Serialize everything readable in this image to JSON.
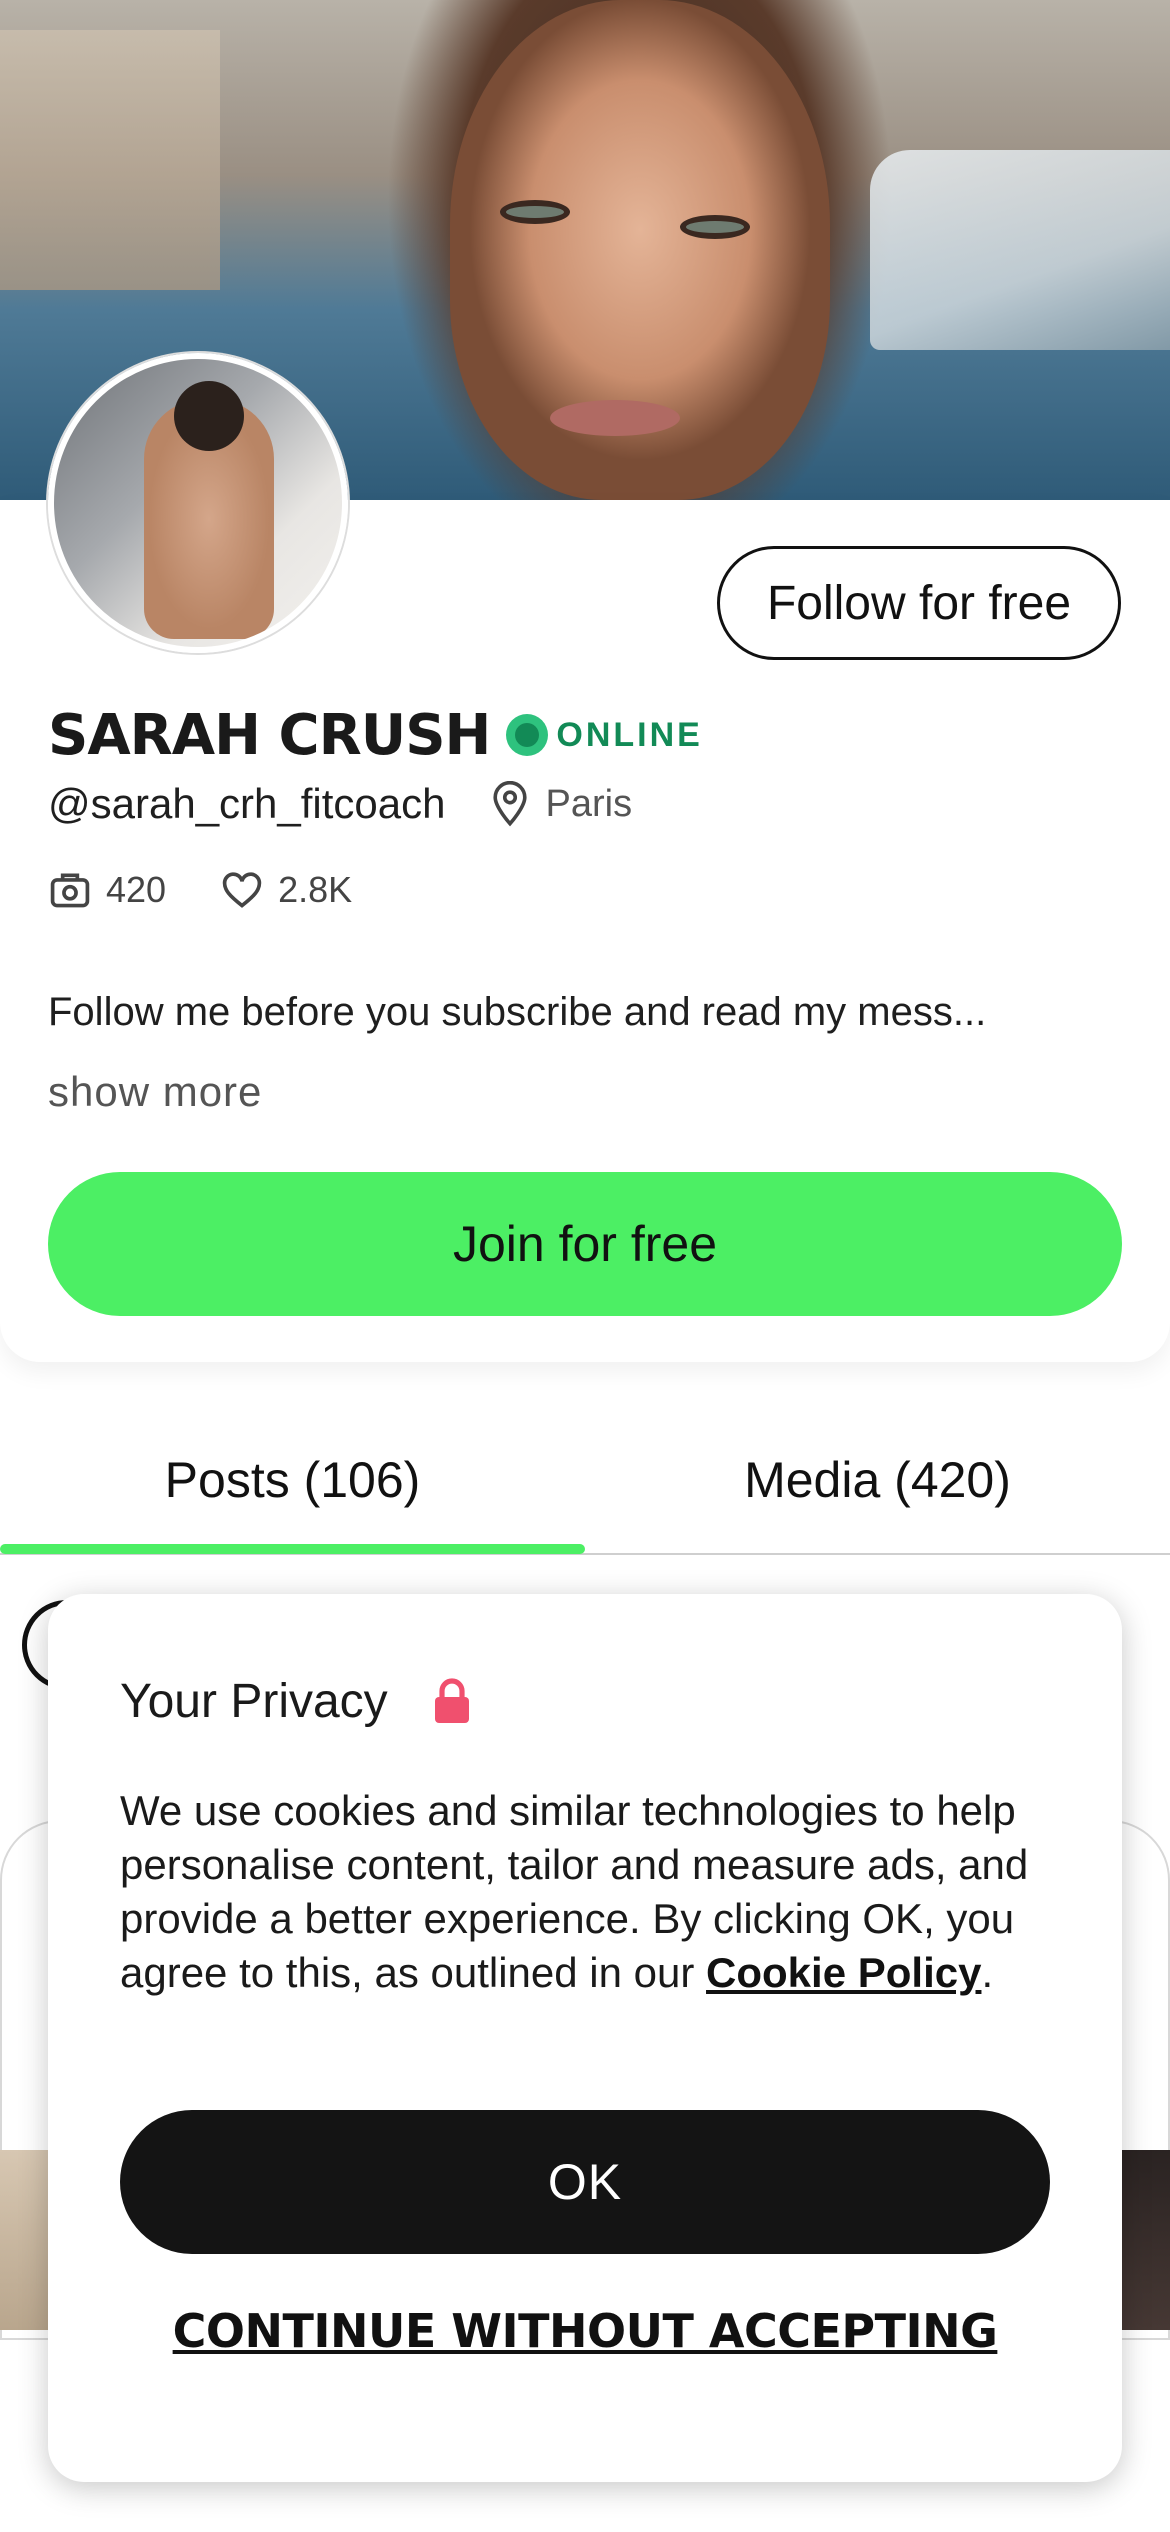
{
  "profile": {
    "name": "SARAH CRUSH",
    "status": "ONLINE",
    "handle": "@sarah_crh_fitcoach",
    "location": "Paris",
    "media_count": "420",
    "likes": "2.8K",
    "bio": "Follow me before you subscribe and read my mess...",
    "show_more": "show more",
    "follow_label": "Follow for free",
    "join_label": "Join for free"
  },
  "tabs": [
    {
      "label": "Posts (106)",
      "active": true
    },
    {
      "label": "Media (420)",
      "active": false
    }
  ],
  "privacy": {
    "title": "Your Privacy",
    "body": "We use cookies and similar technologies to help personalise content, tailor and measure ads, and provide a better experience. By clicking OK, you agree to this, as outlined in our ",
    "policy_link": "Cookie Policy",
    "body_end": ".",
    "ok_label": "OK",
    "continue_label": "CONTINUE WITHOUT ACCEPTING"
  },
  "colors": {
    "accent_green": "#4cef64",
    "online_green": "#128a56",
    "lock_red": "#f0506e"
  },
  "icons": [
    "location-pin-icon",
    "camera-icon",
    "heart-icon",
    "lock-icon"
  ]
}
